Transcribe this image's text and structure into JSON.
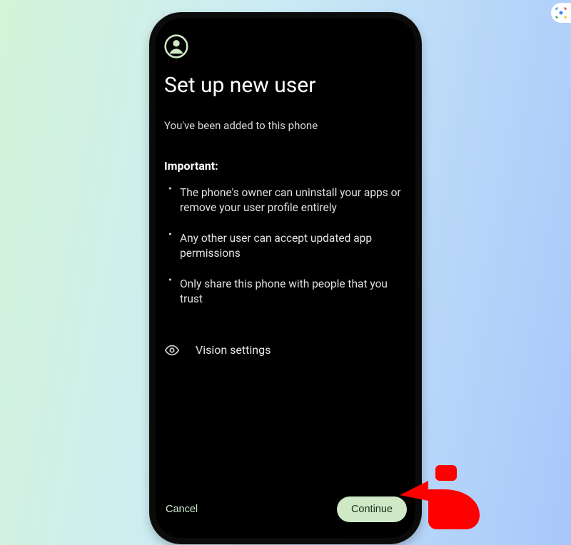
{
  "header": {
    "user_icon": "user-icon",
    "title": "Set up new user",
    "subtitle": "You've been added to this phone"
  },
  "important": {
    "label": "Important:",
    "bullets": [
      "The phone's owner can uninstall your apps or remove your user profile entirely",
      "Any other user can accept updated app permissions",
      "Only share this phone with people that you trust"
    ]
  },
  "vision": {
    "icon": "eye-icon",
    "label": "Vision settings"
  },
  "footer": {
    "cancel": "Cancel",
    "continue": "Continue"
  },
  "colors": {
    "accent_button_bg": "#cfe9c6",
    "accent_button_fg": "#12321a",
    "screen_bg": "#000000",
    "pointer": "#ff0000"
  }
}
